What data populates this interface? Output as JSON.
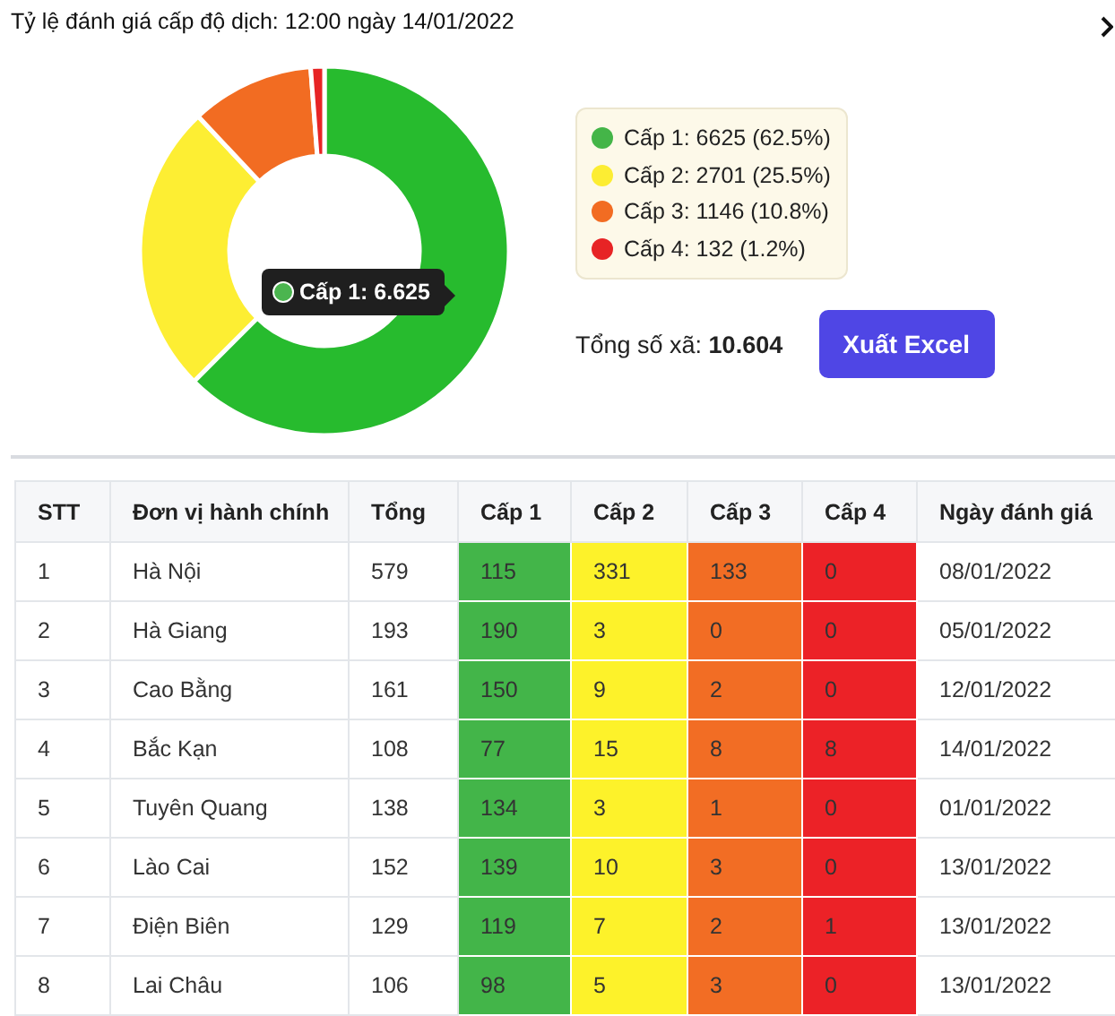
{
  "header": {
    "title": "Tỷ lệ đánh giá cấp độ dịch: 12:00 ngày 14/01/2022"
  },
  "chart": {
    "chart_data": {
      "type": "donut",
      "values": [
        62.5,
        25.5,
        10.8,
        1.2
      ],
      "colors": [
        "#27bb2e",
        "#fdee33",
        "#f26c22",
        "#e72425"
      ]
    },
    "tooltip": {
      "text": "Cấp 1: 6.625",
      "color": "#4bb54f"
    }
  },
  "legend": [
    {
      "label": "Cấp 1: 6625 (62.5%)",
      "color": "#44b548"
    },
    {
      "label": "Cấp 2: 2701 (25.5%)",
      "color": "#fced33"
    },
    {
      "label": "Cấp 3: 1146 (10.8%)",
      "color": "#f26c22"
    },
    {
      "label": "Cấp 4: 132 (1.2%)",
      "color": "#e72425"
    }
  ],
  "summary": {
    "total": "Tổng số xã: **10.604**"
  },
  "export_button": {
    "label": "Xuất Excel"
  },
  "table": {
    "columns": [
      {
        "label": "STT"
      },
      {
        "label": "Đơn vị hành chính"
      },
      {
        "label": "Tổng"
      },
      {
        "label": "Cấp 1",
        "color": "#43b549"
      },
      {
        "label": "Cấp 2",
        "color": "#fdf22a"
      },
      {
        "label": "Cấp 3",
        "color": "#f26d24"
      },
      {
        "label": "Cấp 4",
        "color": "#ec2227"
      },
      {
        "label": "Ngày đánh giá"
      }
    ],
    "rows": [
      [
        "1",
        "Hà Nội",
        "579",
        "115",
        "331",
        "133",
        "0",
        "08/01/2022"
      ],
      [
        "2",
        "Hà Giang",
        "193",
        "190",
        "3",
        "0",
        "0",
        "05/01/2022"
      ],
      [
        "3",
        "Cao Bằng",
        "161",
        "150",
        "9",
        "2",
        "0",
        "12/01/2022"
      ],
      [
        "4",
        "Bắc Kạn",
        "108",
        "77",
        "15",
        "8",
        "8",
        "14/01/2022"
      ],
      [
        "5",
        "Tuyên Quang",
        "138",
        "134",
        "3",
        "1",
        "0",
        "01/01/2022"
      ],
      [
        "6",
        "Lào Cai",
        "152",
        "139",
        "10",
        "3",
        "0",
        "13/01/2022"
      ],
      [
        "7",
        "Điện Biên",
        "129",
        "119",
        "7",
        "2",
        "1",
        "13/01/2022"
      ],
      [
        "8",
        "Lai Châu",
        "106",
        "98",
        "5",
        "3",
        "0",
        "13/01/2022"
      ]
    ]
  }
}
